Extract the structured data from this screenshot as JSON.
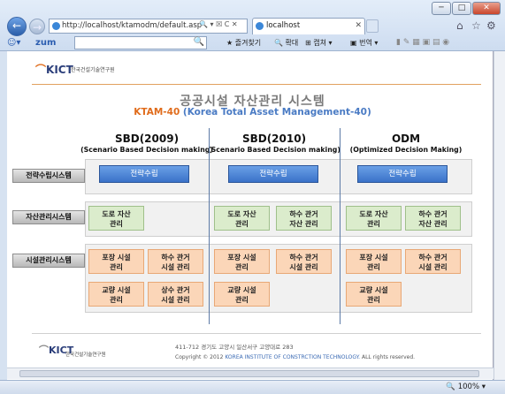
{
  "browser": {
    "window_buttons": {
      "minimize": "─",
      "maximize": "□",
      "close": "✕"
    },
    "back_icon": "←",
    "forward_icon": "→",
    "address": "http://localhost/ktamodm/default.asp",
    "address_controls": "🔍 ▾ ☒ C ✕",
    "tab_title": "localhost",
    "tab_close": "✕",
    "top_icons": {
      "home": "⌂",
      "favorites": "☆",
      "tools": "⚙"
    },
    "toolbar": {
      "zum_logo": "zum",
      "search_icon": "🔍",
      "favorites_label": "즐겨찾기",
      "expand_label": "확대",
      "capture_label": "캡쳐",
      "translate_label": "번역"
    },
    "zoom": "100%"
  },
  "page": {
    "logo": {
      "mark": "KICT",
      "name": "한국건설기술연구원"
    },
    "title": "공공시설 자산관리 시스템",
    "subtitle_main": "KTAM-40",
    "subtitle_paren": "(Korea Total Asset Management-40)",
    "columns": [
      {
        "heading": "SBD(2009)",
        "sub": "(Scenario Based Decision making)"
      },
      {
        "heading": "SBD(2010)",
        "sub": "(Scenario Based Decision making)"
      },
      {
        "heading": "ODM",
        "sub": "(Optimized Decision Making)"
      }
    ],
    "row_labels": {
      "strategy": "전략수립시스템",
      "asset": "자산관리시스템",
      "facility": "시설관리시스템"
    },
    "strategy_buttons": [
      "전략수립",
      "전략수립",
      "전략수립"
    ],
    "asset_boxes": {
      "col1": [
        "도로 자산\n관리"
      ],
      "col2": [
        "도로 자산\n관리",
        "하수 관거\n자산 관리"
      ],
      "col3": [
        "도로 자산\n관리",
        "하수 관거\n자산 관리"
      ]
    },
    "facility_boxes": {
      "col1": [
        "포장 시설\n관리",
        "하수 관거\n시설 관리",
        "교량 시설\n관리",
        "상수 관거\n시설 관리"
      ],
      "col2": [
        "포장 시설\n관리",
        "하수 관거\n시설 관리",
        "교량 시설\n관리"
      ],
      "col3": [
        "포장 시설\n관리",
        "하수 관거\n시설 관리",
        "교량 시설\n관리"
      ]
    },
    "footer": {
      "logo_mark": "KICT",
      "logo_name": "한국건설기술연구원",
      "address": "411-712 경기도 고양시 일산서구 고양대로 283",
      "copy_prefix": "Copyright © 2012",
      "copy_org": "KOREA INSTITUTE OF CONSTRCTION  TECHNOLOGY.",
      "copy_suffix": "ALL rights  reserved."
    }
  }
}
